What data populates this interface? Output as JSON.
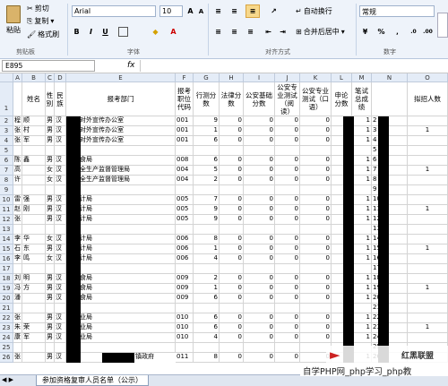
{
  "ribbon": {
    "paste": "粘贴",
    "cut": "剪切",
    "copy": "复制",
    "format_painter": "格式刷",
    "font_name": "Arial",
    "font_size": "10",
    "wrap_text": "自动换行",
    "merge_center": "合并后居中",
    "number_format": "常规",
    "groups": [
      "剪贴板",
      "字体",
      "对齐方式",
      "数字"
    ],
    "bold": "B",
    "italic": "I",
    "underline": "U",
    "percent": "%"
  },
  "formula_bar": {
    "name_box": "E895",
    "fx": "fx",
    "value": ""
  },
  "columns": [
    "A",
    "B",
    "C",
    "D",
    "E",
    "F",
    "G",
    "H",
    "I",
    "J",
    "K",
    "L",
    "M",
    "N",
    "O"
  ],
  "header_row": {
    "num": "1",
    "B": "姓名",
    "C": "性别",
    "D": "民族",
    "E": "报考部门",
    "F": "报考职位代码",
    "G": "行测分数",
    "H": "法律分数",
    "I": "公安基础分数",
    "J": "公安专业测试（阅读）",
    "K": "公安专业测试（口语）",
    "L": "申论分数",
    "M": "笔试总成绩",
    "N": "",
    "O": "拟招人数"
  },
  "rows": [
    {
      "n": "2",
      "a": "程",
      "b": "顺",
      "c": "男",
      "d": "汉",
      "e": "市委对外宣传办公室",
      "f": "001",
      "g": "9",
      "h": "0",
      "i": "0",
      "j": "0",
      "k": "0",
      "l": "5",
      "m": "1",
      "o": ""
    },
    {
      "n": "3",
      "a": "张",
      "b": "村",
      "c": "男",
      "d": "汉",
      "e": "市委对外宣传办公室",
      "f": "001",
      "g": "1",
      "h": "0",
      "i": "0",
      "j": "0",
      "k": "0",
      "l": "5",
      "m": "1",
      "o": "1"
    },
    {
      "n": "4",
      "a": "张",
      "b": "军",
      "c": "男",
      "d": "汉",
      "e": "市委对外宣传办公室",
      "f": "001",
      "g": "6",
      "h": "0",
      "i": "0",
      "j": "0",
      "k": "0",
      "l": "6",
      "m": "1",
      "o": ""
    },
    {
      "n": "5",
      "a": "",
      "b": "",
      "c": "",
      "d": "",
      "e": "",
      "f": "",
      "g": "",
      "h": "",
      "i": "",
      "j": "",
      "k": "",
      "l": "",
      "m": "",
      "o": ""
    },
    {
      "n": "6",
      "a": "陈",
      "b": "鑫",
      "c": "男",
      "d": "汉",
      "e": "市粮食局",
      "f": "008",
      "g": "6",
      "h": "0",
      "i": "0",
      "j": "0",
      "k": "0",
      "l": "8",
      "m": "1",
      "o": ""
    },
    {
      "n": "7",
      "a": "高",
      "b": "",
      "c": "女",
      "d": "汉",
      "e": "市安全生产监督管理局",
      "f": "004",
      "g": "5",
      "h": "0",
      "i": "0",
      "j": "0",
      "k": "0",
      "l": "5",
      "m": "1",
      "o": "1"
    },
    {
      "n": "8",
      "a": "许",
      "b": "",
      "c": "女",
      "d": "汉",
      "e": "市安全生产监督管理局",
      "f": "004",
      "g": "2",
      "h": "0",
      "i": "0",
      "j": "0",
      "k": "0",
      "l": "5",
      "m": "1",
      "o": ""
    },
    {
      "n": "9",
      "a": "",
      "b": "",
      "c": "",
      "d": "",
      "e": "",
      "f": "",
      "g": "",
      "h": "",
      "i": "",
      "j": "",
      "k": "",
      "l": "",
      "m": "",
      "o": ""
    },
    {
      "n": "10",
      "a": "雷",
      "b": "强",
      "c": "男",
      "d": "汉",
      "e": "市审计局",
      "f": "005",
      "g": "7",
      "h": "0",
      "i": "0",
      "j": "0",
      "k": "0",
      "l": "0",
      "m": "1",
      "o": ""
    },
    {
      "n": "11",
      "a": "赵",
      "b": "刚",
      "c": "男",
      "d": "汉",
      "e": "市审计局",
      "f": "005",
      "g": "9",
      "h": "0",
      "i": "0",
      "j": "0",
      "k": "0",
      "l": "5",
      "m": "1",
      "o": "1"
    },
    {
      "n": "12",
      "a": "张",
      "b": "",
      "c": "男",
      "d": "汉",
      "e": "市审计局",
      "f": "005",
      "g": "9",
      "h": "0",
      "i": "0",
      "j": "0",
      "k": "0",
      "l": "5",
      "m": "1",
      "o": ""
    },
    {
      "n": "13",
      "a": "",
      "b": "",
      "c": "",
      "d": "",
      "e": "",
      "f": "",
      "g": "",
      "h": "",
      "i": "",
      "j": "",
      "k": "",
      "l": "",
      "m": "",
      "o": ""
    },
    {
      "n": "14",
      "a": "李",
      "b": "华",
      "c": "女",
      "d": "汉",
      "e": "市审计局",
      "f": "006",
      "g": "8",
      "h": "0",
      "i": "0",
      "j": "0",
      "k": "0",
      "l": "0",
      "m": "1",
      "o": ""
    },
    {
      "n": "15",
      "a": "石",
      "b": "东",
      "c": "男",
      "d": "汉",
      "e": "市审计局",
      "f": "006",
      "g": "1",
      "h": "0",
      "i": "0",
      "j": "0",
      "k": "0",
      "l": "0",
      "m": "1",
      "o": "1"
    },
    {
      "n": "16",
      "a": "李",
      "b": "鸣",
      "c": "女",
      "d": "汉",
      "e": "市审计局",
      "f": "006",
      "g": "4",
      "h": "0",
      "i": "0",
      "j": "0",
      "k": "0",
      "l": "0",
      "m": "1",
      "o": ""
    },
    {
      "n": "17",
      "a": "",
      "b": "",
      "c": "",
      "d": "",
      "e": "",
      "f": "",
      "g": "",
      "h": "",
      "i": "",
      "j": "",
      "k": "",
      "l": "",
      "m": "",
      "o": ""
    },
    {
      "n": "18",
      "a": "刘",
      "b": "明",
      "c": "男",
      "d": "汉",
      "e": "市粮食局",
      "f": "009",
      "g": "2",
      "h": "0",
      "i": "0",
      "j": "0",
      "k": "0",
      "l": "3",
      "m": "1",
      "o": ""
    },
    {
      "n": "19",
      "a": "冯",
      "b": "方",
      "c": "男",
      "d": "汉",
      "e": "市粮食局",
      "f": "009",
      "g": "1",
      "h": "0",
      "i": "0",
      "j": "0",
      "k": "0",
      "l": "1",
      "m": "1",
      "o": "1"
    },
    {
      "n": "20",
      "a": "潘",
      "b": "",
      "c": "男",
      "d": "汉",
      "e": "市粮食局",
      "f": "009",
      "g": "6",
      "h": "0",
      "i": "0",
      "j": "0",
      "k": "0",
      "l": "5",
      "m": "1",
      "o": ""
    },
    {
      "n": "21",
      "a": "",
      "b": "",
      "c": "",
      "d": "",
      "e": "",
      "f": "",
      "g": "",
      "h": "",
      "i": "",
      "j": "",
      "k": "",
      "l": "",
      "m": "",
      "o": ""
    },
    {
      "n": "22",
      "a": "张",
      "b": "",
      "c": "男",
      "d": "汉",
      "e": "市农业局",
      "f": "010",
      "g": "6",
      "h": "0",
      "i": "0",
      "j": "0",
      "k": "0",
      "l": "5",
      "m": "1",
      "o": ""
    },
    {
      "n": "23",
      "a": "朱",
      "b": "荣",
      "c": "男",
      "d": "汉",
      "e": "市农业局",
      "f": "010",
      "g": "6",
      "h": "0",
      "i": "0",
      "j": "0",
      "k": "0",
      "l": "5",
      "m": "1",
      "o": "1"
    },
    {
      "n": "24",
      "a": "康",
      "b": "军",
      "c": "男",
      "d": "汉",
      "e": "市农业局",
      "f": "010",
      "g": "4",
      "h": "0",
      "i": "0",
      "j": "0",
      "k": "0",
      "l": "5",
      "m": "1",
      "o": ""
    },
    {
      "n": "25",
      "a": "",
      "b": "",
      "c": "",
      "d": "",
      "e": "",
      "f": "",
      "g": "",
      "h": "",
      "i": "",
      "j": "",
      "k": "",
      "l": "",
      "m": "",
      "o": ""
    },
    {
      "n": "26",
      "a": "张",
      "b": "",
      "c": "男",
      "d": "汉",
      "e": "市",
      "f": "011",
      "g": "8",
      "h": "0",
      "i": "0",
      "j": "0",
      "k": "0",
      "l": "0",
      "m": "1",
      "o": ""
    }
  ],
  "row26_tail": "镇政府",
  "sheet_tab": "参加资格复审人员名单（公示）",
  "watermark": {
    "brand": "红黑联盟",
    "site": "自学PHP网_php学习_php教"
  }
}
